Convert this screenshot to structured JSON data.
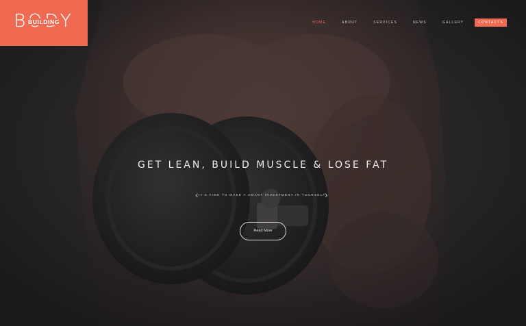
{
  "logo": {
    "title": "BODY",
    "subtitle": "BUILDING"
  },
  "nav": {
    "items": [
      {
        "label": "HOME"
      },
      {
        "label": "ABOUT"
      },
      {
        "label": "SERVICES"
      },
      {
        "label": "NEWS"
      },
      {
        "label": "GALLERY"
      },
      {
        "label": "CONTACTS"
      }
    ],
    "active": "HOME"
  },
  "hero": {
    "headline": "GET LEAN, BUILD MUSCLE & LOSE FAT",
    "subline": "IT'S TIME TO MAKE A SMART INVESTMENT IN YOURSELF!",
    "cta_label": "Read More",
    "prev_icon": "chevron-left-icon",
    "next_icon": "chevron-right-icon"
  },
  "colors": {
    "accent": "#f06a52",
    "background": "#2a2729"
  }
}
